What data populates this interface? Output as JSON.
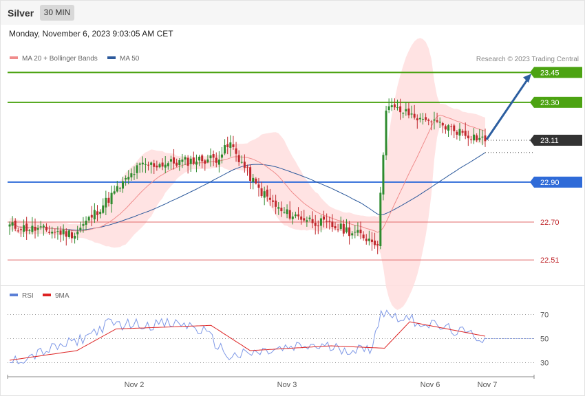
{
  "header": {
    "title": "Silver",
    "timeframe": "30 MIN"
  },
  "date_line": "Monday, November 6, 2023 9:03:05 AM CET",
  "legend_main": [
    {
      "label": "MA 20 + Bollinger Bands",
      "color": "#f08c8c"
    },
    {
      "label": "MA 50",
      "color": "#2d5a9c"
    }
  ],
  "credit": "Research © 2023 Trading Central",
  "legend_rsi": [
    {
      "label": "RSI",
      "color": "#5b7fd6"
    },
    {
      "label": "9MA",
      "color": "#dd2222"
    }
  ],
  "colors": {
    "resistance": "#4ca312",
    "pivot": "#2f6bd8",
    "support": "#e06a6a",
    "up_candle": "#2e8b2e",
    "down_candle": "#c0282d",
    "band": "#ffdede",
    "last_price": "#333333"
  },
  "chart_data": [
    {
      "type": "candlestick",
      "title": "Silver",
      "timeframe": "30 MIN",
      "ylim": [
        22.4,
        23.52
      ],
      "x_ticks": [
        "Nov 2",
        "Nov 3",
        "Nov 6",
        "Nov 7"
      ],
      "levels": [
        {
          "label": "23.45",
          "value": 23.45,
          "kind": "resistance"
        },
        {
          "label": "23.30",
          "value": 23.3,
          "kind": "resistance"
        },
        {
          "label": "23.11",
          "value": 23.11,
          "kind": "last"
        },
        {
          "label": "22.90",
          "value": 22.9,
          "kind": "pivot"
        },
        {
          "label": "22.70",
          "value": 22.7,
          "kind": "support"
        },
        {
          "label": "22.51",
          "value": 22.51,
          "kind": "support"
        }
      ],
      "trend_arrow": {
        "from": 23.11,
        "to": 23.45
      },
      "close_segments": [
        {
          "n": 24,
          "from": 22.68,
          "to": 22.64
        },
        {
          "n": 24,
          "from": 22.64,
          "to": 22.98
        },
        {
          "n": 28,
          "from": 22.98,
          "to": 23.02
        },
        {
          "n": 6,
          "from": 23.02,
          "to": 23.09
        },
        {
          "n": 10,
          "from": 23.09,
          "to": 22.88
        },
        {
          "n": 10,
          "from": 22.88,
          "to": 22.75
        },
        {
          "n": 24,
          "from": 22.75,
          "to": 22.66
        },
        {
          "n": 12,
          "from": 22.66,
          "to": 22.6
        },
        {
          "n": 4,
          "from": 22.6,
          "to": 23.28
        },
        {
          "n": 36,
          "from": 23.28,
          "to": 23.11
        }
      ]
    },
    {
      "type": "line",
      "title": "RSI",
      "ylim": [
        20,
        80
      ],
      "y_ticks": [
        30,
        50,
        70
      ],
      "series": [
        {
          "name": "RSI",
          "segments": [
            {
              "n": 25,
              "from": 30,
              "to": 48
            },
            {
              "n": 12,
              "from": 48,
              "to": 62
            },
            {
              "n": 28,
              "from": 62,
              "to": 62
            },
            {
              "n": 8,
              "from": 62,
              "to": 56
            },
            {
              "n": 10,
              "from": 56,
              "to": 35
            },
            {
              "n": 30,
              "from": 35,
              "to": 44
            },
            {
              "n": 22,
              "from": 44,
              "to": 40
            },
            {
              "n": 5,
              "from": 40,
              "to": 72
            },
            {
              "n": 38,
              "from": 72,
              "to": 50
            }
          ]
        },
        {
          "name": "9MA",
          "segments": [
            {
              "n": 25,
              "from": 32,
              "to": 40
            },
            {
              "n": 15,
              "from": 40,
              "to": 58
            },
            {
              "n": 35,
              "from": 58,
              "to": 61
            },
            {
              "n": 15,
              "from": 61,
              "to": 40
            },
            {
              "n": 30,
              "from": 40,
              "to": 44
            },
            {
              "n": 20,
              "from": 44,
              "to": 42
            },
            {
              "n": 10,
              "from": 42,
              "to": 64
            },
            {
              "n": 28,
              "from": 64,
              "to": 52
            }
          ]
        }
      ]
    }
  ]
}
